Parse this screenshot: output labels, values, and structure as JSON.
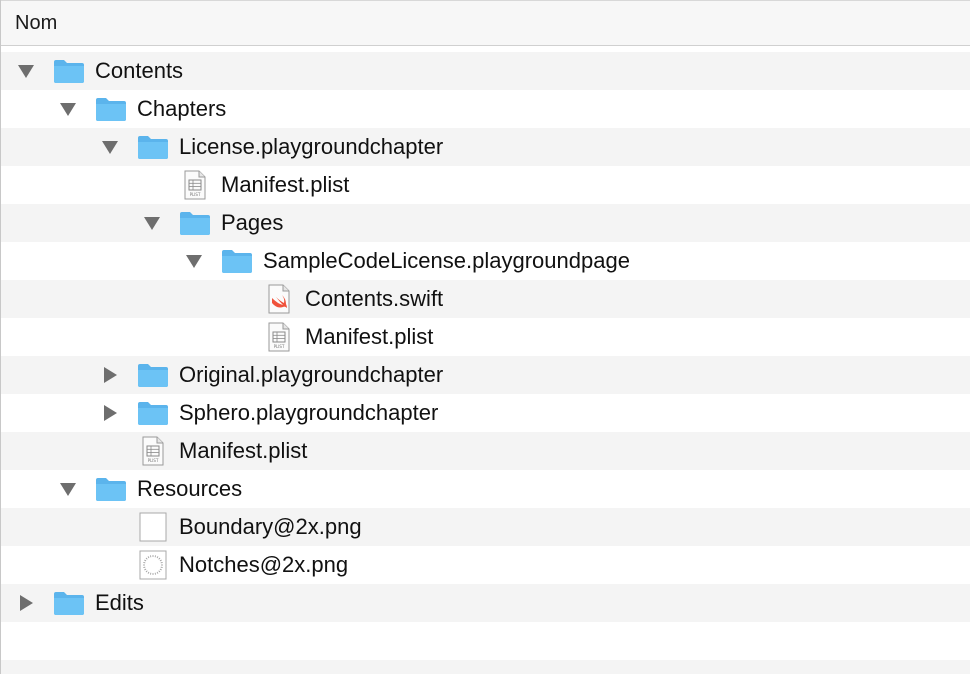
{
  "header": {
    "column_name": "Nom"
  },
  "colors": {
    "folder_fill": "#6cc3f5",
    "folder_tab": "#5bb4ec",
    "stripe": "#f4f4f4",
    "disclosure": "#6e6e6e",
    "swift_orange": "#f0523b"
  },
  "rows": [
    {
      "name": "Contents",
      "depth": 0,
      "kind": "folder",
      "disclosure": "expanded"
    },
    {
      "name": "Chapters",
      "depth": 1,
      "kind": "folder",
      "disclosure": "expanded"
    },
    {
      "name": "License.playgroundchapter",
      "depth": 2,
      "kind": "folder",
      "disclosure": "expanded"
    },
    {
      "name": "Manifest.plist",
      "depth": 3,
      "kind": "plist",
      "disclosure": "none"
    },
    {
      "name": "Pages",
      "depth": 3,
      "kind": "folder",
      "disclosure": "expanded"
    },
    {
      "name": "SampleCodeLicense.playgroundpage",
      "depth": 4,
      "kind": "folder",
      "disclosure": "expanded"
    },
    {
      "name": "Contents.swift",
      "depth": 5,
      "kind": "swift",
      "disclosure": "none"
    },
    {
      "name": "Manifest.plist",
      "depth": 5,
      "kind": "plist",
      "disclosure": "none"
    },
    {
      "name": "Original.playgroundchapter",
      "depth": 2,
      "kind": "folder",
      "disclosure": "collapsed"
    },
    {
      "name": "Sphero.playgroundchapter",
      "depth": 2,
      "kind": "folder",
      "disclosure": "collapsed"
    },
    {
      "name": "Manifest.plist",
      "depth": 2,
      "kind": "plist",
      "disclosure": "none"
    },
    {
      "name": "Resources",
      "depth": 1,
      "kind": "folder",
      "disclosure": "expanded"
    },
    {
      "name": "Boundary@2x.png",
      "depth": 2,
      "kind": "png-blank",
      "disclosure": "none"
    },
    {
      "name": "Notches@2x.png",
      "depth": 2,
      "kind": "png-notches",
      "disclosure": "none"
    },
    {
      "name": "Edits",
      "depth": 0,
      "kind": "folder",
      "disclosure": "collapsed"
    }
  ],
  "icon_names": {
    "folder": "folder-icon",
    "plist": "plist-file-icon",
    "swift": "swift-file-icon",
    "png-blank": "png-image-icon",
    "png-notches": "png-image-icon"
  },
  "plist_badge": "PLIST"
}
